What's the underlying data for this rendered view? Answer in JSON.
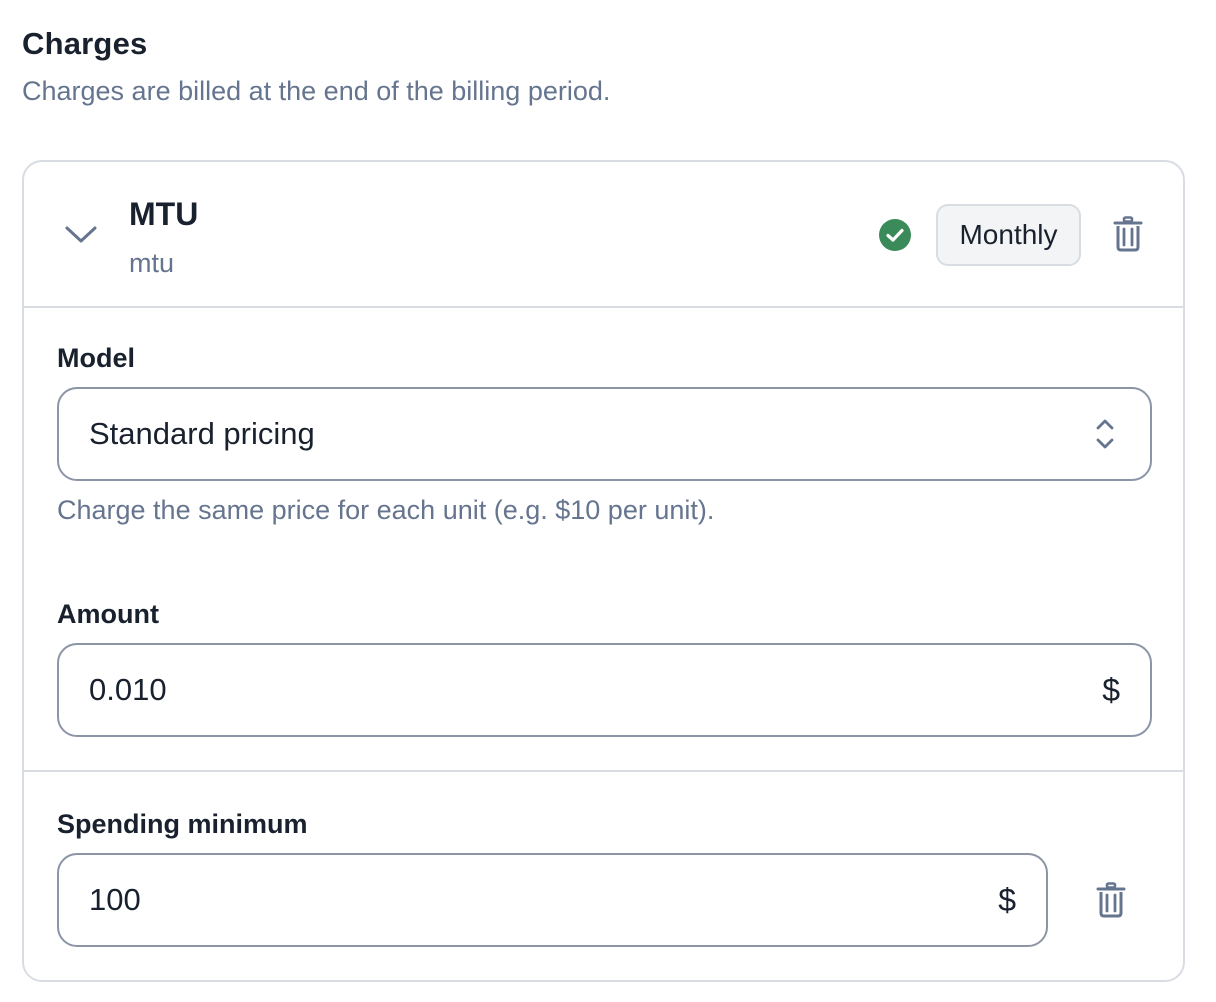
{
  "section": {
    "title": "Charges",
    "description": "Charges are billed at the end of the billing period."
  },
  "charge": {
    "name": "MTU",
    "code": "mtu",
    "status_icon": "check-circle-icon",
    "interval": "Monthly",
    "model": {
      "label": "Model",
      "value": "Standard pricing",
      "help": "Charge the same price for each unit (e.g. $10 per unit)."
    },
    "amount": {
      "label": "Amount",
      "value": "0.010",
      "currency": "$"
    },
    "spending_minimum": {
      "label": "Spending minimum",
      "value": "100",
      "currency": "$"
    }
  },
  "colors": {
    "text_primary": "#19212e",
    "text_secondary": "#66758f",
    "border": "#d9dde3",
    "input_border": "#8c95a6",
    "success": "#3b8a5a",
    "chip_bg": "#f3f4f6"
  }
}
